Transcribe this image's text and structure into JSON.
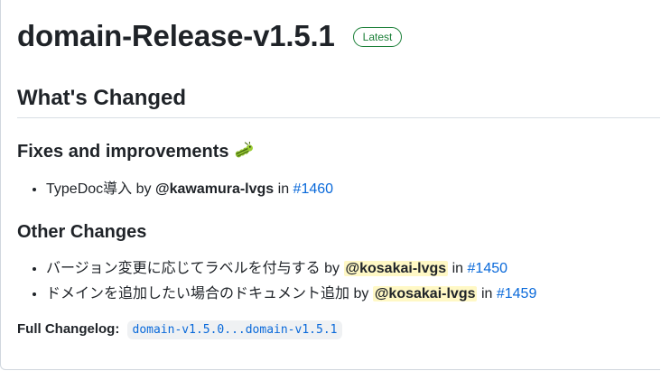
{
  "release": {
    "title": "domain-Release-v1.5.1",
    "badge": "Latest"
  },
  "whats_changed": {
    "heading": "What's Changed"
  },
  "fixes": {
    "heading": "Fixes and improvements",
    "icon": "bug-icon",
    "items": [
      {
        "text": "TypeDoc導入",
        "by": "by",
        "author": "@kawamura-lvgs",
        "in": "in",
        "pr": "#1460"
      }
    ]
  },
  "other": {
    "heading": "Other Changes",
    "items": [
      {
        "text": "バージョン変更に応じてラベルを付与する",
        "by": "by",
        "author": "@kosakai-lvgs",
        "in": "in",
        "pr": "#1450"
      },
      {
        "text": "ドメインを追加したい場合のドキュメント追加",
        "by": "by",
        "author": "@kosakai-lvgs",
        "in": "in",
        "pr": "#1459"
      }
    ]
  },
  "changelog": {
    "label": "Full Changelog:",
    "link": "domain-v1.5.0...domain-v1.5.1"
  },
  "colors": {
    "link": "#0969da",
    "badge": "#1a7f37",
    "highlight": "#fff8c5"
  }
}
